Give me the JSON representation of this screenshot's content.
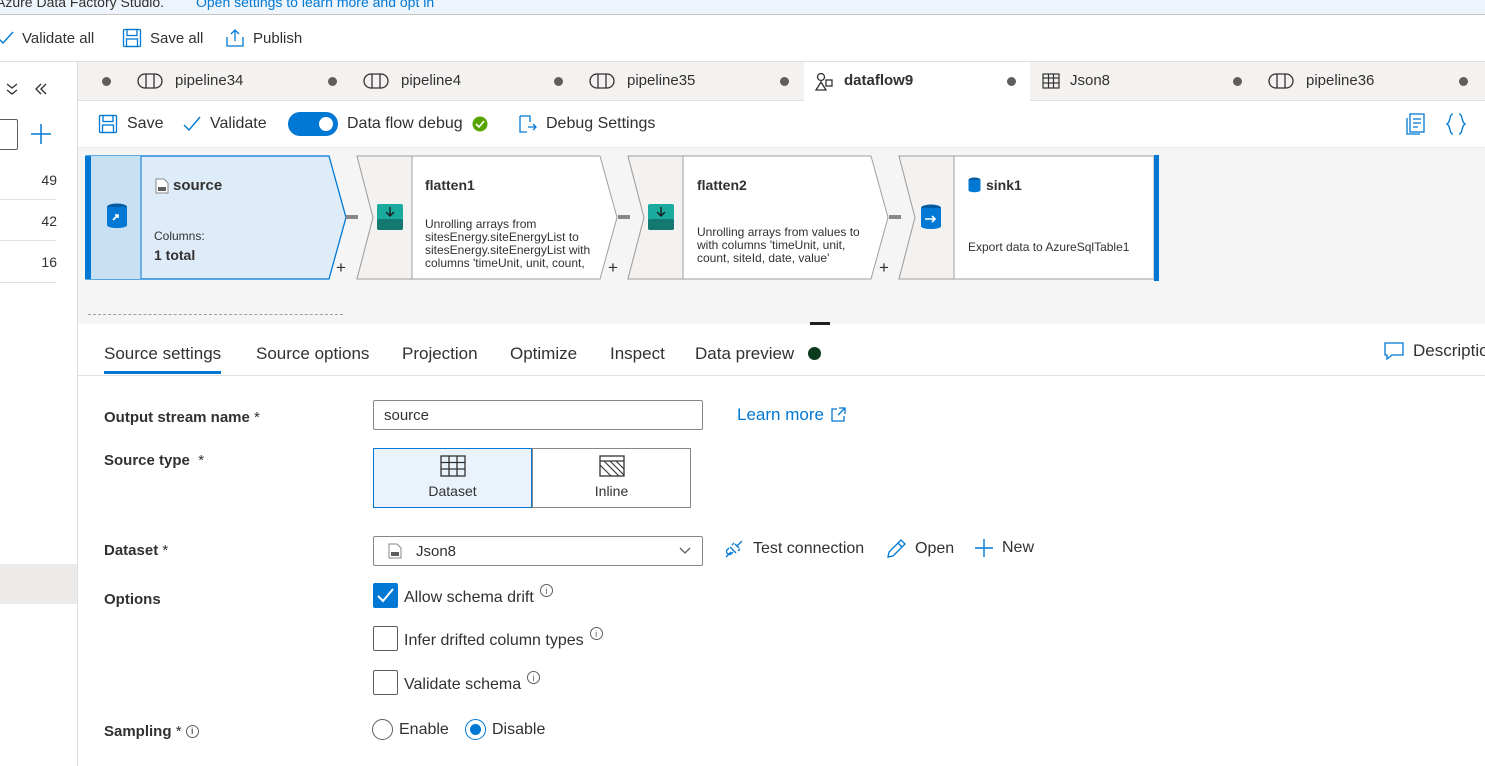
{
  "banner": {
    "text": "Azure Data Factory Studio.",
    "link": "Open settings to learn more and opt in"
  },
  "topbar": {
    "validate_all": "Validate all",
    "save_all": "Save all",
    "publish": "Publish"
  },
  "leftpane": {
    "counts": [
      "49",
      "42",
      "16"
    ]
  },
  "tabs": [
    {
      "label": "pipeline34",
      "icon": "pipeline-icon"
    },
    {
      "label": "pipeline4",
      "icon": "pipeline-icon"
    },
    {
      "label": "pipeline35",
      "icon": "pipeline-icon"
    },
    {
      "label": "dataflow9",
      "icon": "dataflow-icon",
      "active": true
    },
    {
      "label": "Json8",
      "icon": "dataset-icon"
    },
    {
      "label": "pipeline36",
      "icon": "pipeline-icon"
    }
  ],
  "toolbar": {
    "save": "Save",
    "validate": "Validate",
    "debug_label": "Data flow debug",
    "debug_on": true,
    "debug_settings": "Debug Settings"
  },
  "flow": {
    "nodes": [
      {
        "title": "source",
        "desc_label": "Columns:",
        "desc_value": "1 total"
      },
      {
        "title": "flatten1",
        "desc": "Unrolling arrays from sitesEnergy.siteEnergyList to sitesEnergy.siteEnergyList with columns 'timeUnit, unit, count, siteId, date, value'"
      },
      {
        "title": "flatten2",
        "desc": "Unrolling arrays from values to with columns 'timeUnit, unit, count, siteId, date, value'"
      },
      {
        "title": "sink1",
        "desc": "Export data to AzureSqlTable1"
      }
    ],
    "plus": "+"
  },
  "panel_tabs": [
    "Source settings",
    "Source options",
    "Projection",
    "Optimize",
    "Inspect",
    "Data preview"
  ],
  "panel": {
    "description": "Description"
  },
  "form": {
    "output_stream_label": "Output stream name",
    "required_mark": "*",
    "output_stream_value": "source",
    "learn_more": "Learn more",
    "source_type_label": "Source type",
    "source_type_options": [
      "Dataset",
      "Inline"
    ],
    "source_type_selected": "Dataset",
    "dataset_label": "Dataset",
    "dataset_value": "Json8",
    "test_connection": "Test connection",
    "open": "Open",
    "new": "New",
    "options_label": "Options",
    "allow_schema_drift": "Allow schema drift",
    "allow_schema_drift_checked": true,
    "infer_drifted": "Infer drifted column types",
    "validate_schema": "Validate schema",
    "sampling_label": "Sampling",
    "sampling_enable": "Enable",
    "sampling_disable": "Disable",
    "sampling_selected": "Disable",
    "info_glyph": "i"
  },
  "colors": {
    "accent": "#0078d4",
    "debug_ok": "#57a300",
    "node_selected_bg": "#deecf9",
    "transform_teal": "#1aaa9e"
  }
}
